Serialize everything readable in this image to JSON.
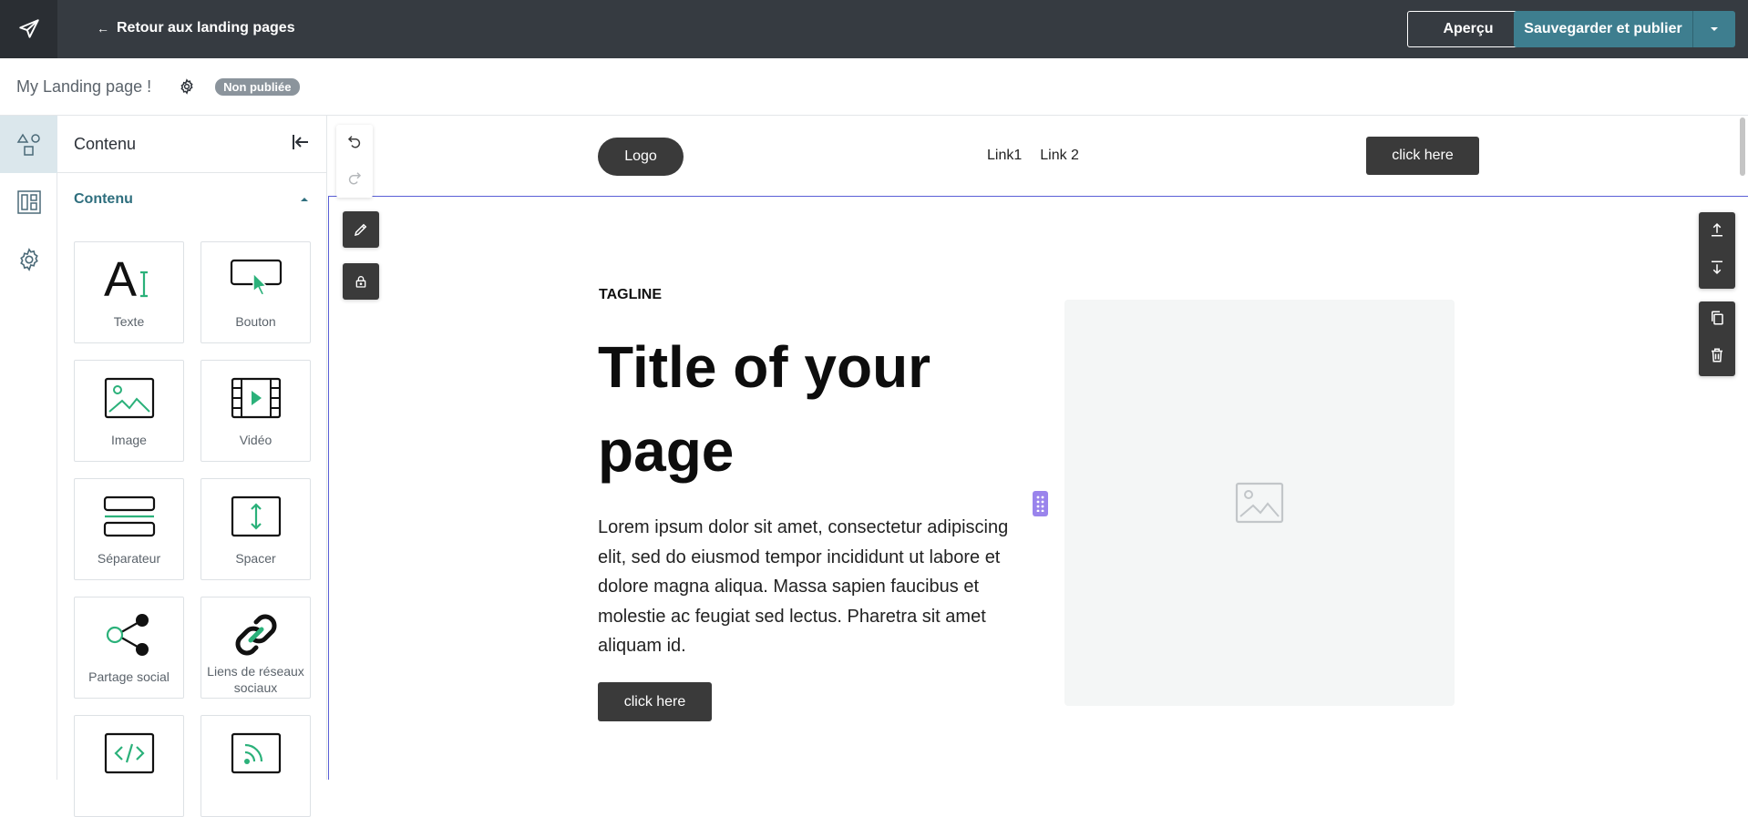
{
  "topbar": {
    "back_label": "Retour aux landing pages",
    "preview_label": "Aperçu",
    "save_label": "Sauvegarder et publier"
  },
  "subbar": {
    "page_name": "My Landing page !",
    "status_badge": "Non publiée"
  },
  "panel": {
    "title": "Contenu",
    "section_title": "Contenu",
    "tiles": [
      {
        "label": "Texte",
        "icon": "text-icon"
      },
      {
        "label": "Bouton",
        "icon": "button-icon"
      },
      {
        "label": "Image",
        "icon": "image-icon"
      },
      {
        "label": "Vidéo",
        "icon": "video-icon"
      },
      {
        "label": "Séparateur",
        "icon": "divider-icon"
      },
      {
        "label": "Spacer",
        "icon": "spacer-icon"
      },
      {
        "label": "Partage social",
        "icon": "share-icon"
      },
      {
        "label": "Liens de réseaux sociaux",
        "icon": "link-icon"
      },
      {
        "label": "",
        "icon": "code-icon"
      },
      {
        "label": "",
        "icon": "rss-icon"
      }
    ]
  },
  "canvas": {
    "logo": "Logo",
    "links": [
      "Link1",
      "Link 2"
    ],
    "header_cta": "click here",
    "tagline": "TAGLINE",
    "title": "Title of your page",
    "body": "Lorem ipsum dolor sit amet, consectetur adipiscing elit, sed do eiusmod tempor incididunt ut labore et dolore magna aliqua. Massa sapien faucibus et molestie ac feugiat sed lectus. Pharetra sit amet aliquam id.",
    "hero_cta": "click here"
  },
  "colors": {
    "topbar": "#363b41",
    "primary": "#3e7e8f",
    "accent_green": "#2bb17a",
    "selection": "#5a5fd6",
    "drag_handle": "#9a84ec"
  }
}
